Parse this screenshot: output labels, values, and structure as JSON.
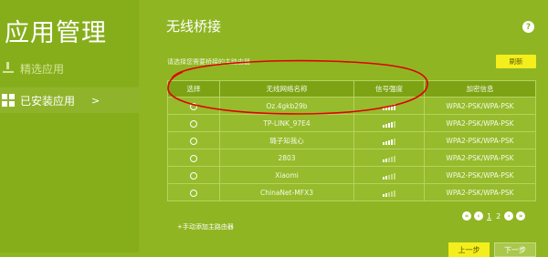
{
  "sidebar": {
    "title": "应用管理",
    "items": [
      {
        "label": "精选应用",
        "icon": "download-icon"
      },
      {
        "label": "已安装应用",
        "icon": "grid-icon",
        "chevron": ">"
      }
    ]
  },
  "main": {
    "title": "无线桥接",
    "help": "?",
    "prompt": "请选择您需要桥接的主路由器",
    "refresh_label": "刷新",
    "table": {
      "headers": [
        "选择",
        "无线网络名称",
        "信号强度",
        "加密信息"
      ],
      "rows": [
        {
          "name": "Oz.4gkb29b",
          "signal": 5,
          "security": "WPA2-PSK/WPA-PSK"
        },
        {
          "name": "TP-LINK_97E4",
          "signal": 4,
          "security": "WPA2-PSK/WPA-PSK"
        },
        {
          "name": "璐子知我心",
          "signal": 4,
          "security": "WPA2-PSK/WPA-PSK"
        },
        {
          "name": "2803",
          "signal": 2,
          "security": "WPA2-PSK/WPA-PSK"
        },
        {
          "name": "Xiaomi",
          "signal": 2,
          "security": "WPA2-PSK/WPA-PSK"
        },
        {
          "name": "ChinaNet-MFX3",
          "signal": 2,
          "security": "WPA2-PSK/WPA-PSK"
        }
      ]
    },
    "add_link": "+手动添加主路由器",
    "pager": {
      "pages": [
        "1",
        "2"
      ],
      "current": "1"
    },
    "prev_label": "上一步",
    "next_label": "下一步"
  },
  "colors": {
    "background": "#8fb523",
    "sidebar": "#86ae1b",
    "button_yellow": "#f4ee1c",
    "annotation": "#e00000"
  }
}
